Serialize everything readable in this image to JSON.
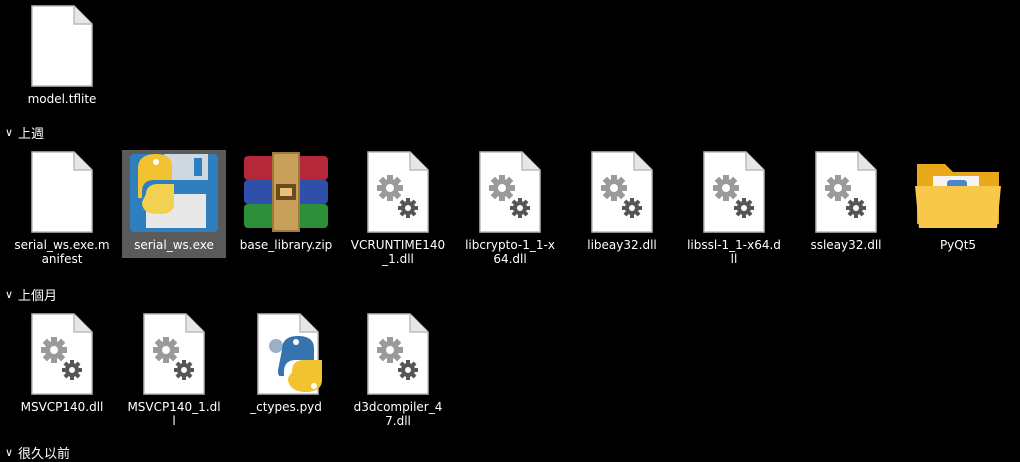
{
  "top_file": {
    "label": "model.tflite"
  },
  "groups": [
    {
      "label": "上週"
    },
    {
      "label": "上個月"
    },
    {
      "label": "很久以前"
    }
  ],
  "last_week_files": [
    {
      "label": "serial_ws.exe.manifest",
      "icon": "blank-file-icon"
    },
    {
      "label": "serial_ws.exe",
      "icon": "python-floppy-icon"
    },
    {
      "label": "base_library.zip",
      "icon": "winrar-archive-icon"
    },
    {
      "label": "VCRUNTIME140_1.dll",
      "icon": "dll-gear-icon"
    },
    {
      "label": "libcrypto-1_1-x64.dll",
      "icon": "dll-gear-icon"
    },
    {
      "label": "libeay32.dll",
      "icon": "dll-gear-icon"
    },
    {
      "label": "libssl-1_1-x64.dll",
      "icon": "dll-gear-icon"
    },
    {
      "label": "ssleay32.dll",
      "icon": "dll-gear-icon"
    },
    {
      "label": "PyQt5",
      "icon": "folder-icon"
    }
  ],
  "last_month_files": [
    {
      "label": "MSVCP140.dll",
      "icon": "dll-gear-icon"
    },
    {
      "label": "MSVCP140_1.dll",
      "icon": "dll-gear-icon"
    },
    {
      "label": "_ctypes.pyd",
      "icon": "python-file-icon"
    },
    {
      "label": "d3dcompiler_47.dll",
      "icon": "dll-gear-icon"
    }
  ],
  "colors": {
    "background": "#000000",
    "selection": "#5a5a5a",
    "text": "#ffffff"
  }
}
